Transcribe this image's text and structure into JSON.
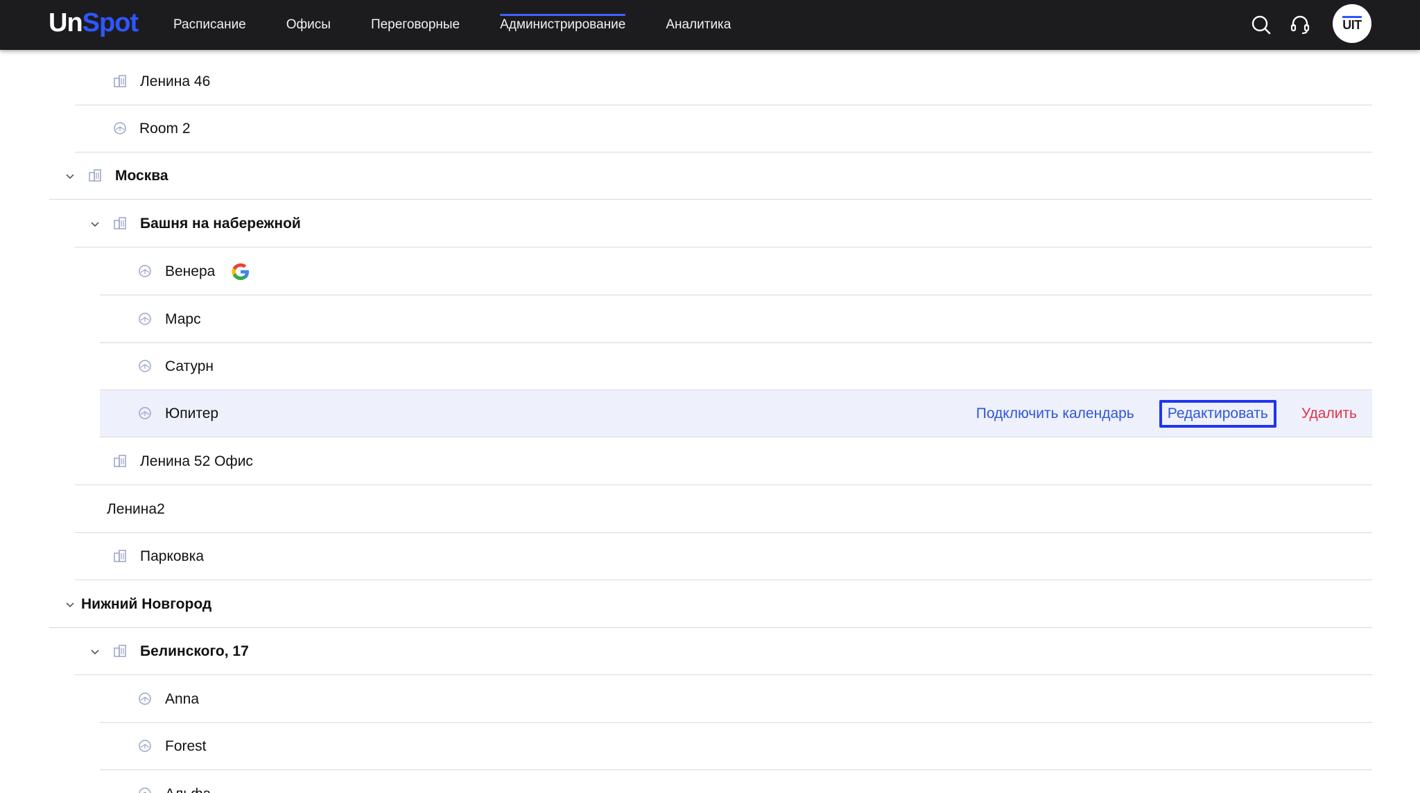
{
  "app": {
    "logo_part1": "Un",
    "logo_part2": "Spot",
    "avatar_text": "UIT",
    "brand_color": "#2f56ff"
  },
  "nav": {
    "items": [
      "Расписание",
      "Офисы",
      "Переговорные",
      "Администрирование",
      "Аналитика"
    ],
    "active_index": 3
  },
  "header_icons": [
    "search-icon",
    "headset-icon"
  ],
  "tree": [
    {
      "label": "Ленина 46",
      "bold": false,
      "icon": "building-icon",
      "chevron": false
    },
    {
      "label": "Room 2",
      "bold": false,
      "icon": "room-icon",
      "chevron": false
    },
    {
      "label": "Москва",
      "bold": true,
      "icon": "building-icon",
      "chevron": true
    },
    {
      "label": "Башня на набережной",
      "bold": true,
      "icon": "building-icon",
      "chevron": true
    },
    {
      "label": "Венера",
      "bold": false,
      "icon": "room-icon",
      "chevron": false,
      "google": true
    },
    {
      "label": "Марс",
      "bold": false,
      "icon": "room-icon",
      "chevron": false
    },
    {
      "label": "Сатурн",
      "bold": false,
      "icon": "room-icon",
      "chevron": false
    },
    {
      "label": "Юпитер",
      "bold": false,
      "icon": "room-icon",
      "chevron": false,
      "selected": true
    },
    {
      "label": "Ленина 52 Офис",
      "bold": false,
      "icon": "building-icon",
      "chevron": false
    },
    {
      "label": "Ленина2",
      "bold": false,
      "icon": "",
      "chevron": false
    },
    {
      "label": "Парковка",
      "bold": false,
      "icon": "building-icon",
      "chevron": false
    },
    {
      "label": "Нижний Новгород",
      "bold": true,
      "icon": "",
      "chevron": true
    },
    {
      "label": "Белинского, 17",
      "bold": true,
      "icon": "building-icon",
      "chevron": true
    },
    {
      "label": "Anna",
      "bold": false,
      "icon": "room-icon",
      "chevron": false
    },
    {
      "label": "Forest",
      "bold": false,
      "icon": "room-icon",
      "chevron": false
    },
    {
      "label": "Альфа",
      "bold": false,
      "icon": "room-icon",
      "chevron": false
    }
  ],
  "row_actions": {
    "connect_calendar": "Подключить календарь",
    "edit": "Редактировать",
    "delete": "Удалить"
  },
  "colors": {
    "topbar": "#1c1c1f",
    "link": "#2f56d8",
    "delete": "#e0324a",
    "selected_row": "#eef1fb",
    "focus_outline": "#1f35f0"
  }
}
